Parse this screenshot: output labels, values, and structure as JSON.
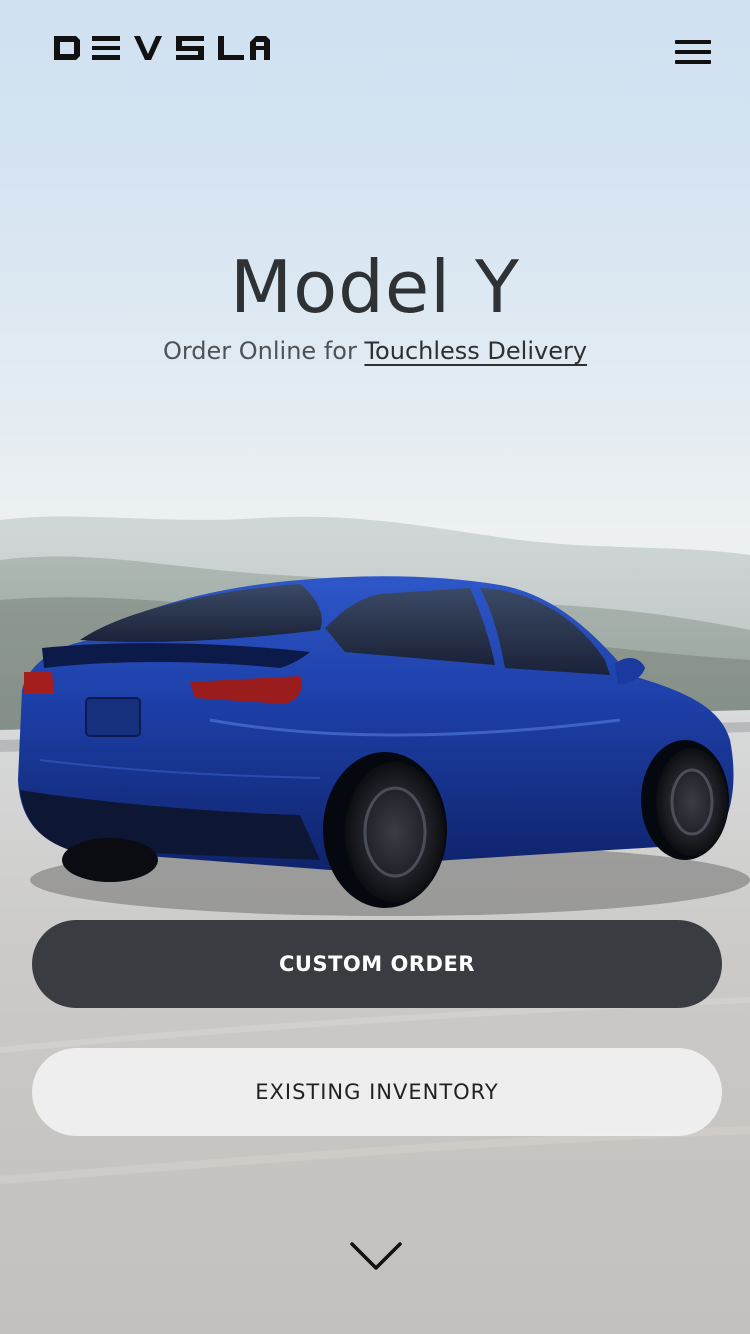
{
  "header": {
    "brand_icon": "devsla-wordmark-logo",
    "menu_icon": "hamburger-menu-icon"
  },
  "hero": {
    "title": "Model Y",
    "subtitle_prefix": "Order Online for ",
    "subtitle_link": "Touchless Delivery",
    "image": "blue-suv-on-road"
  },
  "actions": {
    "primary_label": "CUSTOM ORDER",
    "secondary_label": "EXISTING INVENTORY"
  },
  "footer": {
    "scroll_icon": "chevron-down-icon"
  },
  "colors": {
    "primary_button": "#393c41",
    "secondary_button": "#f4f4f4",
    "car_body": "#1f3fa6",
    "title_text": "#2f3234"
  }
}
